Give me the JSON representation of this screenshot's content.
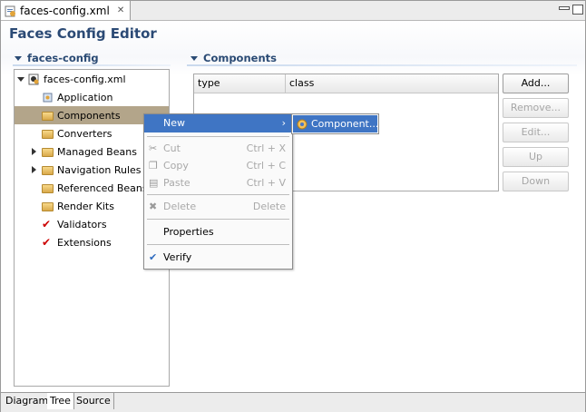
{
  "editor_tab": {
    "label": "faces-config.xml",
    "close_glyph": "✕"
  },
  "editor": {
    "title": "Faces Config Editor"
  },
  "tree_section": {
    "title": "faces-config",
    "root": "faces-config.xml",
    "items": [
      {
        "label": "Application",
        "icon": "application-icon",
        "expandable": false
      },
      {
        "label": "Components",
        "icon": "folder-icon",
        "expandable": false,
        "selected": true
      },
      {
        "label": "Converters",
        "icon": "folder-icon",
        "expandable": false
      },
      {
        "label": "Managed Beans",
        "icon": "folder-icon",
        "expandable": true
      },
      {
        "label": "Navigation Rules",
        "icon": "folder-icon",
        "expandable": true
      },
      {
        "label": "Referenced Beans",
        "icon": "folder-icon",
        "expandable": false
      },
      {
        "label": "Render Kits",
        "icon": "folder-icon",
        "expandable": false
      },
      {
        "label": "Validators",
        "icon": "check-icon",
        "expandable": false
      },
      {
        "label": "Extensions",
        "icon": "check-icon",
        "expandable": false
      }
    ]
  },
  "components_section": {
    "title": "Components",
    "columns": [
      "type",
      "class"
    ],
    "rows": []
  },
  "buttons": {
    "add": "Add...",
    "remove": "Remove...",
    "edit": "Edit...",
    "up": "Up",
    "down": "Down"
  },
  "context_menu": {
    "new": "New",
    "cut": "Cut",
    "cut_shortcut": "Ctrl + X",
    "copy": "Copy",
    "copy_shortcut": "Ctrl + C",
    "paste": "Paste",
    "paste_shortcut": "Ctrl + V",
    "delete": "Delete",
    "delete_shortcut": "Delete",
    "properties": "Properties",
    "verify": "Verify"
  },
  "submenu": {
    "component": "Component..."
  },
  "bottom_tabs": [
    "Diagram",
    "Tree",
    "Source"
  ],
  "colors": {
    "accent": "#3f75c4",
    "selection": "#b3a58a",
    "heading": "#2a4a74"
  }
}
